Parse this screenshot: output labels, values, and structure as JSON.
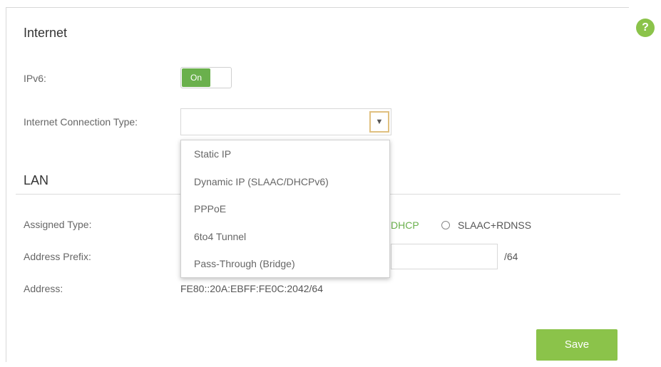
{
  "help": {
    "icon": "help-icon",
    "glyph": "?"
  },
  "internet": {
    "title": "Internet",
    "ipv6_label": "IPv6:",
    "ipv6_toggle": "On",
    "connection_type_label": "Internet Connection Type:",
    "connection_type_value": "",
    "connection_type_options": [
      "Static IP",
      "Dynamic IP (SLAAC/DHCPv6)",
      "PPPoE",
      "6to4 Tunnel",
      "Pass-Through (Bridge)"
    ]
  },
  "lan": {
    "title": "LAN",
    "assigned_type_label": "Assigned Type:",
    "assigned_type_options": [
      "DHCP",
      "SLAAC+RDNSS"
    ],
    "address_prefix_label": "Address Prefix:",
    "address_prefix_value": "",
    "prefix_suffix": "/64",
    "address_label": "Address:",
    "address_value": "FE80::20A:EBFF:FE0C:2042/64"
  },
  "actions": {
    "save_label": "Save"
  },
  "colors": {
    "accent": "#8bc34a",
    "toggle_on": "#6ab04c",
    "dhcp_text": "#6ab04c"
  }
}
